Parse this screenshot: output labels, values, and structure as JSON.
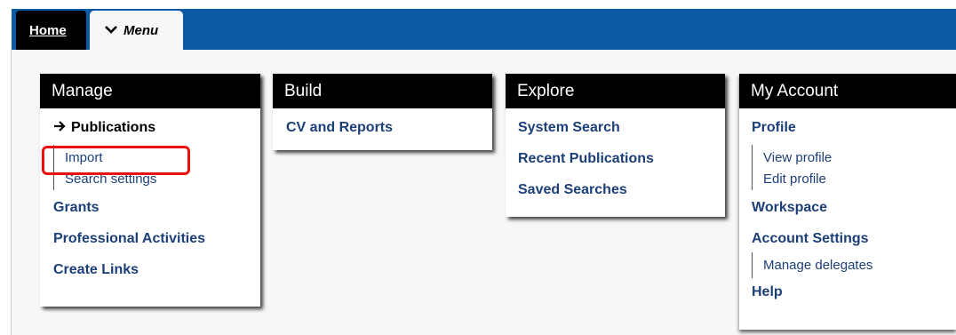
{
  "tabs": {
    "home_label": "Home",
    "menu_label": "Menu"
  },
  "manage": {
    "title": "Manage",
    "publications_label": "Publications",
    "publications_subitems": [
      "Import",
      "Search settings"
    ],
    "items": [
      "Grants",
      "Professional Activities",
      "Create Links"
    ]
  },
  "build": {
    "title": "Build",
    "items": [
      "CV and Reports"
    ]
  },
  "explore": {
    "title": "Explore",
    "items": [
      "System Search",
      "Recent Publications",
      "Saved Searches"
    ]
  },
  "account": {
    "title": "My Account",
    "profile_label": "Profile",
    "profile_subitems": [
      "View profile",
      "Edit profile"
    ],
    "workspace_label": "Workspace",
    "settings_label": "Account Settings",
    "settings_subitems": [
      "Manage delegates"
    ],
    "help_label": "Help"
  },
  "colors": {
    "topbar": "#0b5aa3",
    "link": "#1c3f78",
    "highlight": "#e81010"
  }
}
